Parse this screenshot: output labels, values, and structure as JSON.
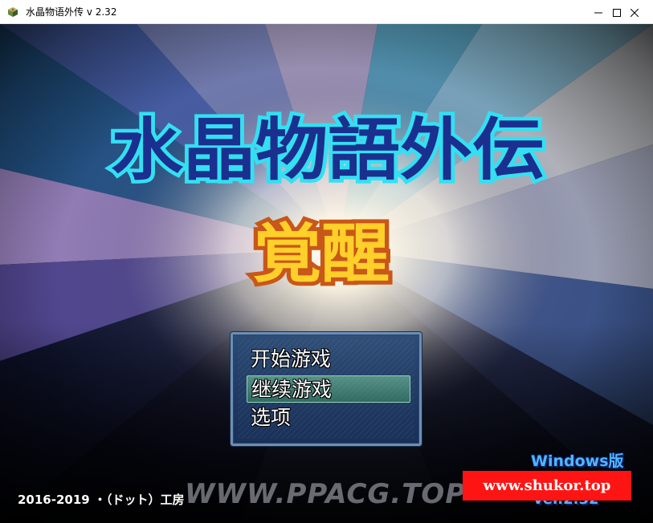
{
  "window": {
    "title": "水晶物语外传 v 2.32",
    "icon": "app-icon",
    "controls": {
      "minimize_icon": "minimize-icon",
      "maximize_icon": "maximize-icon",
      "close_icon": "close-icon"
    }
  },
  "logo": {
    "title": "水晶物語外伝",
    "subtitle": "覚醒",
    "title_color": "#1b2f8f",
    "title_outline": "#33e0f2",
    "subtitle_color": "#ffcf2a",
    "subtitle_outline": "#c8571a"
  },
  "menu": {
    "items": [
      {
        "label": "开始游戏"
      },
      {
        "label": "继续游戏",
        "selected": true
      },
      {
        "label": "选项"
      }
    ]
  },
  "footer": {
    "copyright": "2016-2019 ・（ドット）工房",
    "edition": "Windows版",
    "version": "ver.2.32"
  },
  "watermarks": {
    "ppacg": "WWW.PPACG.TOP",
    "shukor": "www.shukor.top",
    "shukor_bg": "#ff1414"
  }
}
